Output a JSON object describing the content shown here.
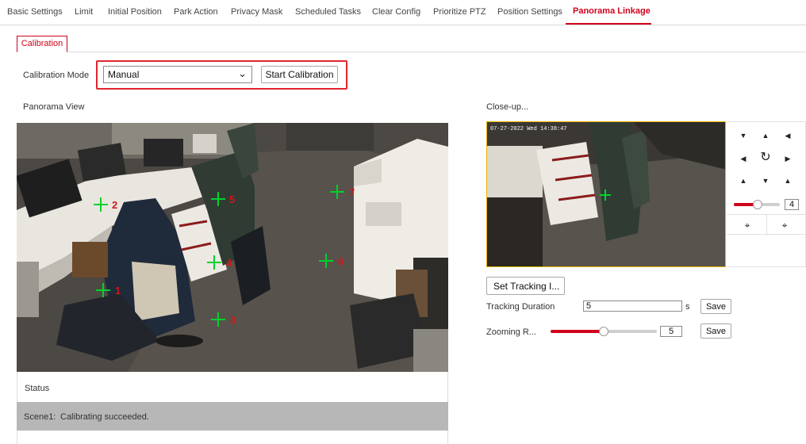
{
  "tabs": [
    {
      "label": "Basic Settings",
      "active": false
    },
    {
      "label": "Limit",
      "active": false
    },
    {
      "label": "Initial Position",
      "active": false
    },
    {
      "label": "Park Action",
      "active": false
    },
    {
      "label": "Privacy Mask",
      "active": false
    },
    {
      "label": "Scheduled Tasks",
      "active": false
    },
    {
      "label": "Clear Config",
      "active": false
    },
    {
      "label": "Prioritize PTZ",
      "active": false
    },
    {
      "label": "Position Settings",
      "active": false
    },
    {
      "label": "Panorama Linkage",
      "active": true
    }
  ],
  "subtab": {
    "label": "Calibration"
  },
  "calibration": {
    "mode_label": "Calibration Mode",
    "mode_value": "Manual",
    "start_button": "Start Calibration"
  },
  "panorama": {
    "title": "Panorama View",
    "markers": [
      {
        "label": "1"
      },
      {
        "label": "2"
      },
      {
        "label": "3"
      },
      {
        "label": "4"
      },
      {
        "label": "5"
      },
      {
        "label": "6"
      },
      {
        "label": "7"
      }
    ]
  },
  "status": {
    "header": "Status",
    "scene": "Scene1:",
    "message": "Calibrating succeeded."
  },
  "closeup": {
    "title": "Close-up...",
    "timestamp": "07-27-2022 Wed 14:38:47",
    "zoom_value": "4"
  },
  "tracking": {
    "set_button": "Set Tracking I...",
    "duration_label": "Tracking Duration",
    "duration_value": "5",
    "duration_unit": "s",
    "duration_save": "Save",
    "zoom_label": "Zooming R...",
    "zoom_value": "5",
    "zoom_level": 0.5,
    "zoom_save": "Save"
  },
  "colors": {
    "accent": "#d0021b",
    "marker": "#00d22a",
    "status_bg": "#b7b7b7",
    "closeup_border": "#e8b400"
  }
}
